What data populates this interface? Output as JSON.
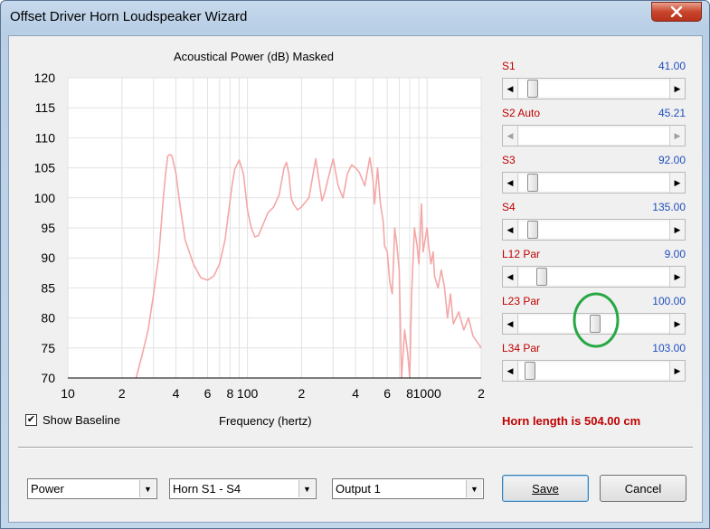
{
  "window": {
    "title": "Offset Driver Horn Loudspeaker Wizard"
  },
  "chart": {
    "title": "Acoustical Power (dB)   Masked",
    "xlabel": "Frequency (hertz)"
  },
  "chart_data": {
    "type": "line",
    "title": "Acoustical Power (dB)   Masked",
    "xlabel": "Frequency (hertz)",
    "ylabel": "",
    "xscale": "log",
    "xlim": [
      10,
      2000
    ],
    "ylim": [
      70,
      120
    ],
    "y_ticks": [
      70,
      75,
      80,
      85,
      90,
      95,
      100,
      105,
      110,
      115,
      120
    ],
    "x_tick_labels": [
      "10",
      "2",
      "4",
      "6",
      "8",
      "100",
      "2",
      "4",
      "6",
      "8",
      "1000",
      "2"
    ],
    "grid": true,
    "series": [
      {
        "color": "#f4a7a7",
        "x": [
          24,
          26,
          28,
          30,
          32,
          33,
          34,
          35,
          36,
          37,
          38,
          40,
          42,
          45,
          50,
          55,
          60,
          65,
          70,
          75,
          78,
          82,
          85,
          90,
          95,
          100,
          105,
          110,
          115,
          120,
          130,
          140,
          150,
          160,
          165,
          170,
          175,
          180,
          190,
          200,
          220,
          240,
          250,
          260,
          270,
          280,
          300,
          320,
          340,
          360,
          380,
          400,
          420,
          450,
          480,
          500,
          510,
          530,
          550,
          570,
          580,
          600,
          620,
          640,
          660,
          680,
          700,
          720,
          750,
          780,
          800,
          820,
          850,
          880,
          900,
          930,
          950,
          1000,
          1020,
          1050,
          1080,
          1100,
          1150,
          1200,
          1250,
          1300,
          1350,
          1400,
          1500,
          1600,
          1700,
          1800,
          1900,
          2000
        ],
        "y": [
          70,
          74,
          78,
          84,
          90,
          95,
          100,
          104,
          107,
          107.2,
          107,
          104,
          99,
          93,
          89,
          86.7,
          86.3,
          87,
          89,
          93,
          97,
          102,
          104.8,
          106.3,
          104,
          98,
          95,
          93.5,
          93.7,
          95,
          97.5,
          98.5,
          100.5,
          105,
          105.9,
          104,
          100,
          99,
          98,
          98.5,
          100,
          106.5,
          103,
          99.5,
          101,
          103,
          106.5,
          102,
          100,
          104,
          105.5,
          105,
          104.2,
          102,
          106.7,
          103,
          99,
          105,
          99,
          96,
          92,
          91,
          86,
          84,
          95,
          92,
          88,
          70,
          78,
          74,
          70,
          84,
          95,
          92,
          89,
          99,
          91,
          95,
          92,
          89,
          91,
          87,
          85,
          88,
          85,
          80,
          84,
          79,
          81,
          78,
          80,
          77,
          76,
          75
        ]
      }
    ]
  },
  "sliders": [
    {
      "label": "S1",
      "value": "41.00",
      "pos": 0.06,
      "disabled": false
    },
    {
      "label": "S2  Auto",
      "value": "45.21",
      "pos": 0.0,
      "disabled": true
    },
    {
      "label": "S3",
      "value": "92.00",
      "pos": 0.06,
      "disabled": false
    },
    {
      "label": "S4",
      "value": "135.00",
      "pos": 0.06,
      "disabled": false
    },
    {
      "label": "L12  Par",
      "value": "9.00",
      "pos": 0.12,
      "disabled": false
    },
    {
      "label": "L23  Par",
      "value": "100.00",
      "pos": 0.5,
      "disabled": false
    },
    {
      "label": "L34  Par",
      "value": "103.00",
      "pos": 0.04,
      "disabled": false
    }
  ],
  "baseline": {
    "label": "Show Baseline",
    "checked": true
  },
  "horn_length": "Horn length is 504.00 cm",
  "combos": {
    "mode": "Power",
    "horn": "Horn S1 - S4",
    "output": "Output 1"
  },
  "buttons": {
    "save": "Save",
    "cancel": "Cancel"
  },
  "colors": {
    "label_red": "#c00000",
    "value_blue": "#1f4fbd",
    "curve": "#f4a7a7",
    "annotation": "#27a844"
  }
}
